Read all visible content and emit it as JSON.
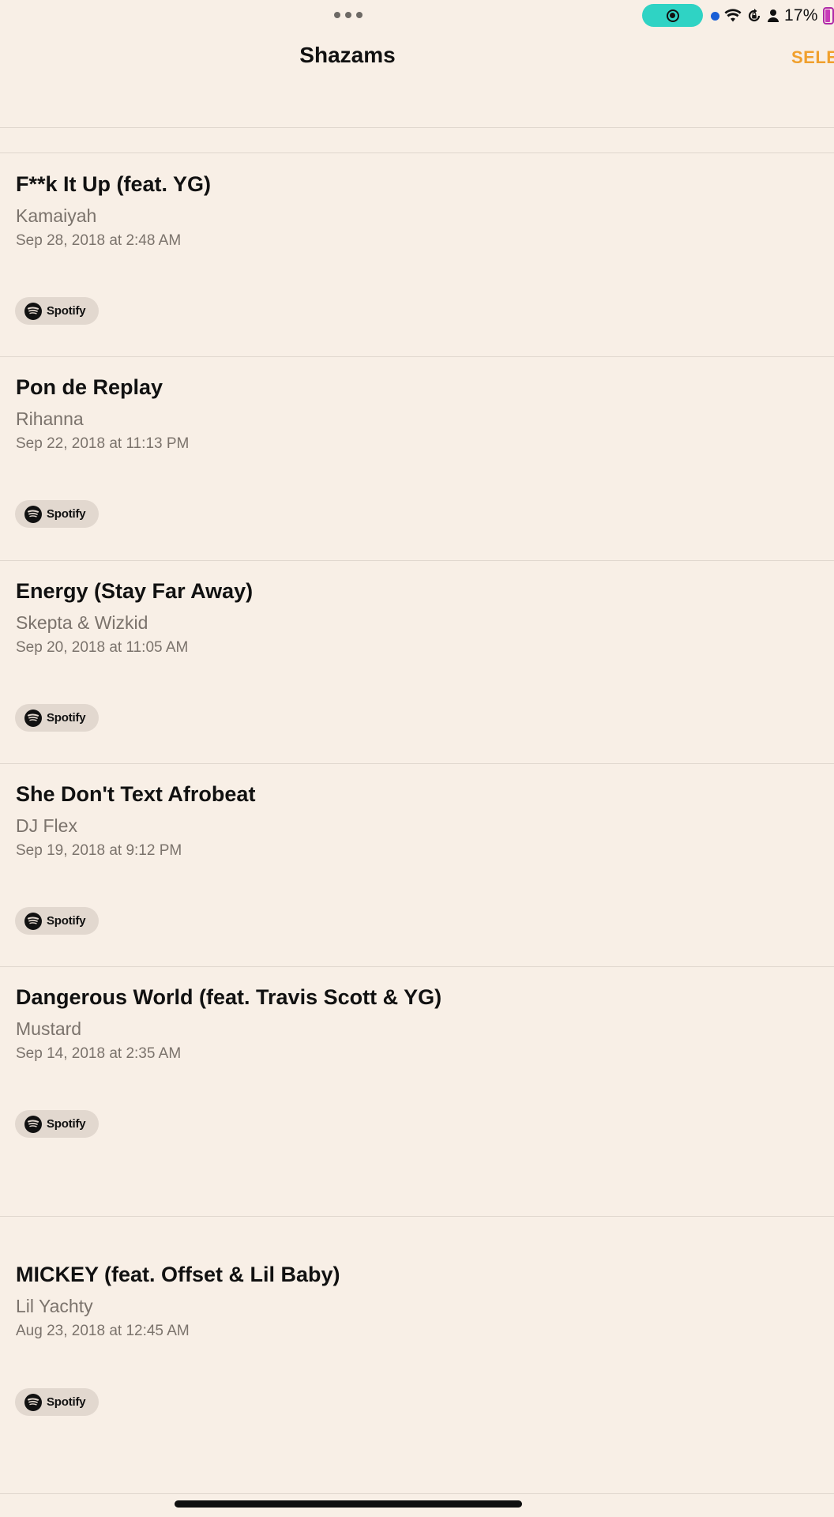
{
  "status_bar": {
    "battery_percent": "17%",
    "icons": [
      "screen-recording-icon",
      "location-dot-icon",
      "wifi-icon",
      "orientation-lock-icon",
      "person-icon",
      "battery-icon"
    ]
  },
  "header": {
    "title": "Shazams",
    "select_label": "SELE"
  },
  "shazams": [
    {
      "title": "F**k It Up (feat. YG)",
      "artist": "Kamaiyah",
      "date": "Sep 28, 2018 at 2:48 AM",
      "service": "Spotify"
    },
    {
      "title": "Pon de Replay",
      "artist": "Rihanna",
      "date": "Sep 22, 2018 at 11:13 PM",
      "service": "Spotify"
    },
    {
      "title": "Energy (Stay Far Away)",
      "artist": "Skepta & Wizkid",
      "date": "Sep 20, 2018 at 11:05 AM",
      "service": "Spotify"
    },
    {
      "title": "She Don't Text Afrobeat",
      "artist": "DJ Flex",
      "date": "Sep 19, 2018 at 9:12 PM",
      "service": "Spotify"
    },
    {
      "title": "Dangerous World (feat. Travis Scott & YG)",
      "artist": "Mustard",
      "date": "Sep 14, 2018 at 2:35 AM",
      "service": "Spotify"
    },
    {
      "title": "MICKEY (feat. Offset & Lil Baby)",
      "artist": "Lil Yachty",
      "date": "Aug 23, 2018 at 12:45 AM",
      "service": "Spotify"
    }
  ],
  "colors": {
    "background": "#f8efe6",
    "accent": "#f0a02d",
    "recording_pill": "#2fd3c4"
  }
}
